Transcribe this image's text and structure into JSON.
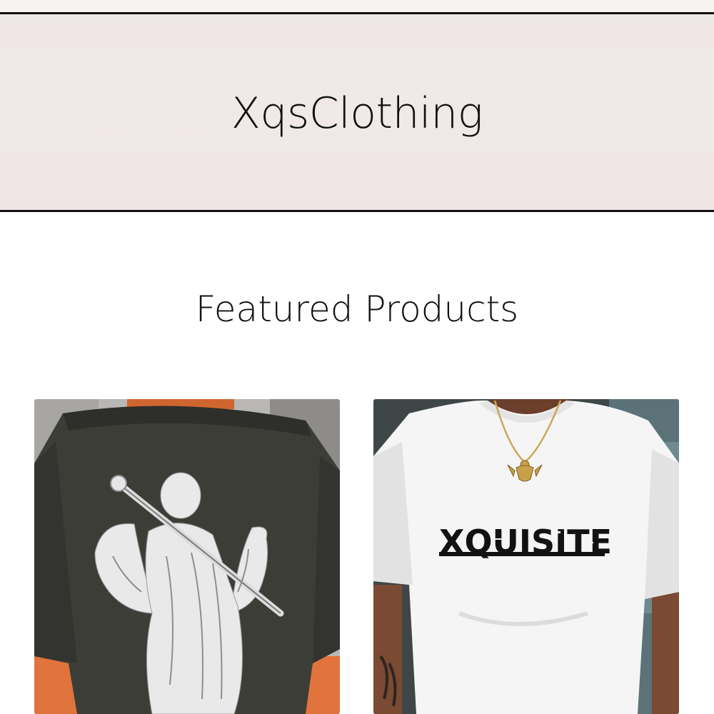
{
  "header": {
    "brand": "XqsClothing"
  },
  "featured": {
    "title": "Featured Products",
    "products": [
      {
        "image": "black-tshirt-angel-statue-print"
      },
      {
        "image": "white-tshirt-xquisite-print",
        "print_text": "XQUISITE"
      }
    ]
  },
  "colors": {
    "header_bg": "#f0e7e7",
    "border": "#111111",
    "text": "#111111"
  }
}
